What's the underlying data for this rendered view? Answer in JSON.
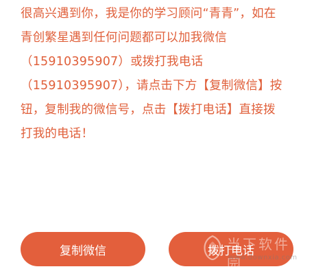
{
  "message": {
    "lines": [
      "很高兴遇到你，我是你的学习顾问“青青”，如在",
      "青创繁星遇到任何问题都可以加我微信",
      "（15910395907）或拨打我电话",
      "（15910395907），请点击下方【复制微信】按",
      "钮，复制我的微信号，点击【拨打电话】直接拨",
      "打我的电话！"
    ]
  },
  "buttons": {
    "copy_wechat": "复制微信",
    "call_phone": "拨打电话"
  },
  "watermark": {
    "text": "当下软件园",
    "url": "www.downxia.com"
  },
  "colors": {
    "text": "#e0603b",
    "button": "#e35f3c",
    "button_text": "#ffffff",
    "background": "#ffffff"
  }
}
